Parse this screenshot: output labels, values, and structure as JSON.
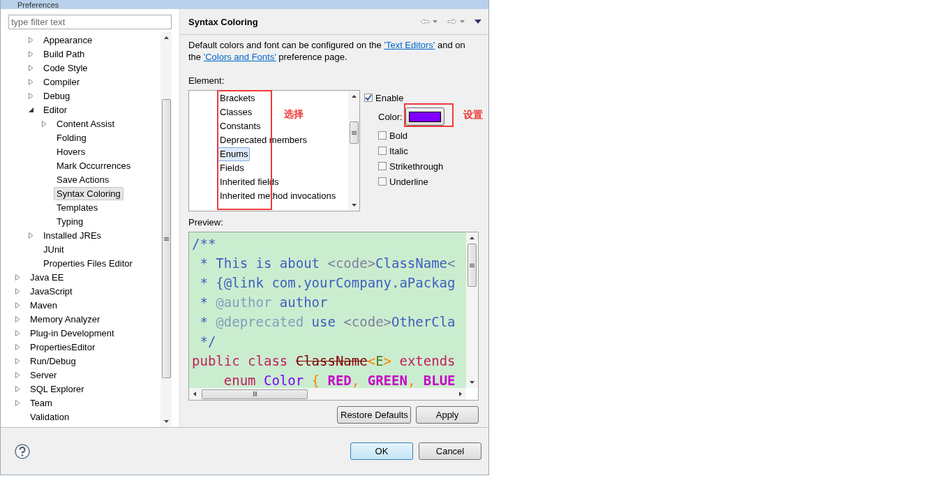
{
  "window": {
    "title": "Preferences"
  },
  "filter": {
    "placeholder": "type filter text"
  },
  "tree": [
    {
      "children": [
        {
          "label": "Appearance",
          "expanded": false,
          "selected": false
        },
        {
          "label": "Build Path",
          "expanded": false,
          "selected": false
        },
        {
          "label": "Code Style",
          "expanded": false,
          "selected": false
        },
        {
          "label": "Compiler",
          "expanded": false,
          "selected": false
        },
        {
          "label": "Debug",
          "expanded": false,
          "selected": false
        },
        {
          "label": "Editor",
          "expanded": true,
          "selected": false,
          "children": [
            {
              "label": "Content Assist",
              "expanded": false,
              "selected": false
            },
            {
              "label": "Folding",
              "selected": false
            },
            {
              "label": "Hovers",
              "selected": false
            },
            {
              "label": "Mark Occurrences",
              "selected": false
            },
            {
              "label": "Save Actions",
              "selected": false
            },
            {
              "label": "Syntax Coloring",
              "selected": true
            },
            {
              "label": "Templates",
              "selected": false
            },
            {
              "label": "Typing",
              "selected": false
            }
          ]
        },
        {
          "label": "Installed JREs",
          "expanded": false,
          "selected": false
        },
        {
          "label": "JUnit",
          "selected": false
        },
        {
          "label": "Properties Files Editor",
          "selected": false
        }
      ]
    },
    {
      "label": "Java EE",
      "expanded": false,
      "selected": false
    },
    {
      "label": "JavaScript",
      "expanded": false,
      "selected": false
    },
    {
      "label": "Maven",
      "expanded": false,
      "selected": false
    },
    {
      "label": "Memory Analyzer",
      "expanded": false,
      "selected": false
    },
    {
      "label": "Plug-in Development",
      "expanded": false,
      "selected": false
    },
    {
      "label": "PropertiesEditor",
      "expanded": false,
      "selected": false
    },
    {
      "label": "Run/Debug",
      "expanded": false,
      "selected": false
    },
    {
      "label": "Server",
      "expanded": false,
      "selected": false
    },
    {
      "label": "SQL Explorer",
      "expanded": false,
      "selected": false
    },
    {
      "label": "Team",
      "expanded": false,
      "selected": false
    },
    {
      "label": "Validation",
      "selected": false
    }
  ],
  "page": {
    "title": "Syntax Coloring",
    "description": "Default colors and font can be configured on the ",
    "link_1": "'Text Editors'",
    "description_2": " and on the ",
    "link_2": "'Colors and Fonts'",
    "description_3": " preference page.",
    "element_label": "Element:",
    "elements": [
      {
        "label": "Brackets",
        "selected": false
      },
      {
        "label": "Classes",
        "selected": false
      },
      {
        "label": "Constants",
        "selected": false
      },
      {
        "label": "Deprecated members",
        "selected": false
      },
      {
        "label": "Enums",
        "selected": true
      },
      {
        "label": "Fields",
        "selected": false
      },
      {
        "label": "Inherited fields",
        "selected": false
      },
      {
        "label": "Inherited method invocations",
        "selected": false
      }
    ],
    "enable": {
      "label": "Enable",
      "checked": true
    },
    "color_label": "Color:",
    "color": "#8000ff",
    "styles": [
      {
        "label": "Bold",
        "checked": false
      },
      {
        "label": "Italic",
        "checked": false
      },
      {
        "label": "Strikethrough",
        "checked": false
      },
      {
        "label": "Underline",
        "checked": false
      }
    ],
    "preview_label": "Preview:",
    "preview": [
      [
        {
          "text": "/**",
          "kind": "doc"
        }
      ],
      [
        {
          "text": " * This is about ",
          "kind": "doc"
        },
        {
          "text": "<code>",
          "kind": "tag"
        },
        {
          "text": "ClassName",
          "kind": "doc"
        },
        {
          "text": "<",
          "kind": "tag"
        }
      ],
      [
        {
          "text": " * {@link com.yourCompany.aPackag",
          "kind": "doc"
        }
      ],
      [
        {
          "text": " * ",
          "kind": "doc"
        },
        {
          "text": "@author",
          "kind": "doctag"
        },
        {
          "text": " author",
          "kind": "doc"
        }
      ],
      [
        {
          "text": " * ",
          "kind": "doc"
        },
        {
          "text": "@deprecated",
          "kind": "doctag"
        },
        {
          "text": " use ",
          "kind": "doc"
        },
        {
          "text": "<code>",
          "kind": "tag"
        },
        {
          "text": "OtherCla",
          "kind": "doc"
        }
      ],
      [
        {
          "text": " */",
          "kind": "doc"
        }
      ],
      [
        {
          "text": "public class ",
          "kind": "keyword"
        },
        {
          "text": "ClassName",
          "kind": "deprecated"
        },
        {
          "text": "<",
          "kind": "bracket"
        },
        {
          "text": "E",
          "kind": "typeparam"
        },
        {
          "text": ">",
          "kind": "bracket"
        },
        {
          "text": " extends",
          "kind": "keyword"
        }
      ],
      [
        {
          "text": "    enum ",
          "kind": "keyword"
        },
        {
          "text": "Color ",
          "kind": "enum"
        },
        {
          "text": "{ ",
          "kind": "bracket"
        },
        {
          "text": "RED",
          "kind": "constant"
        },
        {
          "text": ", ",
          "kind": "bracket"
        },
        {
          "text": "GREEN",
          "kind": "constant"
        },
        {
          "text": ", ",
          "kind": "bracket"
        },
        {
          "text": "BLUE",
          "kind": "constant"
        }
      ]
    ],
    "restore_button": "Restore Defaults",
    "apply_button": "Apply"
  },
  "buttons": {
    "ok": "OK",
    "cancel": "Cancel"
  },
  "annotations": {
    "select_note": "选择",
    "set_note": "设置"
  }
}
